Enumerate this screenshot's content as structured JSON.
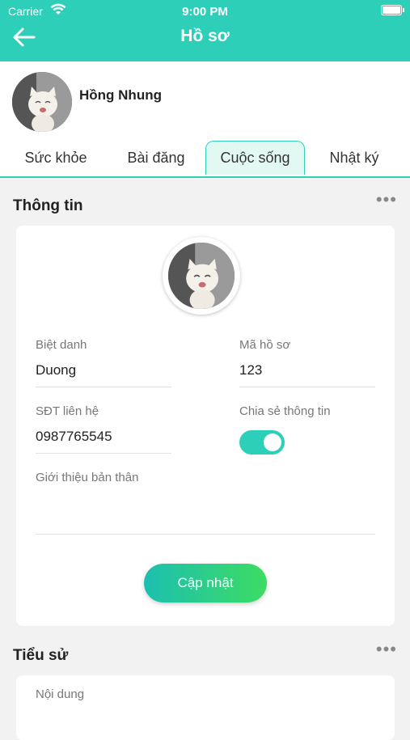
{
  "status_bar": {
    "carrier": "Carrier",
    "time": "9:00 PM"
  },
  "header": {
    "title": "Hồ sơ"
  },
  "profile": {
    "name": "Hồng Nhung"
  },
  "tabs": [
    {
      "label": "Sức khỏe"
    },
    {
      "label": "Bài đăng"
    },
    {
      "label": "Cuộc sống",
      "active": true
    },
    {
      "label": "Nhật ký"
    }
  ],
  "info": {
    "title": "Thông tin",
    "nickname_label": "Biệt danh",
    "nickname_value": "Duong",
    "profile_code_label": "Mã hồ sơ",
    "profile_code_value": "123",
    "phone_label": "SĐT liên hệ",
    "phone_value": "0987765545",
    "share_label": "Chia sẻ thông tin",
    "share_enabled": true,
    "intro_label": "Giới thiệu bản thân",
    "update_button": "Cập nhật"
  },
  "bio": {
    "title": "Tiểu sử",
    "content_label": "Nội dung"
  },
  "colors": {
    "accent": "#2ecfb9",
    "button_start": "#1cbfb0",
    "button_end": "#3ddc63"
  }
}
